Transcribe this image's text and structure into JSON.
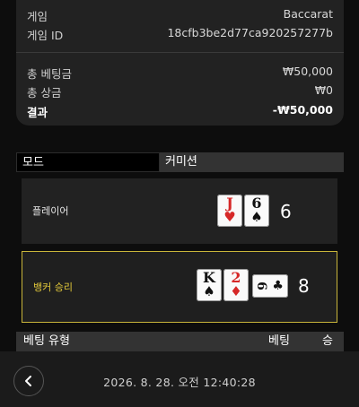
{
  "summary": {
    "game_label": "게임",
    "game_value": "Baccarat",
    "game_id_label": "게임 ID",
    "game_id_value": "18cfb3be2d77ca920257277b",
    "total_bet_label": "총 베팅금",
    "total_bet_value": "₩50,000",
    "total_win_label": "총 상금",
    "total_win_value": "₩0",
    "result_label": "결과",
    "result_value": "-₩50,000"
  },
  "tabs": {
    "mode": "모드",
    "commission": "커미션"
  },
  "player": {
    "label": "플레이어",
    "score": "6",
    "cards": [
      {
        "rank": "J",
        "suit": "♥",
        "color": "#d62828"
      },
      {
        "rank": "6",
        "suit": "♠",
        "color": "#111111"
      }
    ]
  },
  "banker": {
    "label": "뱅커 승리",
    "score": "8",
    "cards": [
      {
        "rank": "K",
        "suit": "♠",
        "color": "#111111"
      },
      {
        "rank": "2",
        "suit": "♦",
        "color": "#d62828"
      },
      {
        "rank": "6",
        "suit": "♣",
        "color": "#111111"
      }
    ]
  },
  "bet_table": {
    "col_type": "베팅 유형",
    "col_bet": "베팅",
    "col_win": "승"
  },
  "footer": {
    "timestamp": "2026. 8. 28. 오전 12:40:28",
    "back_icon": "chevron-left-icon"
  },
  "colors": {
    "banker_accent": "#c9b53a",
    "background": "#0d0d0d",
    "panel": "#222222"
  }
}
